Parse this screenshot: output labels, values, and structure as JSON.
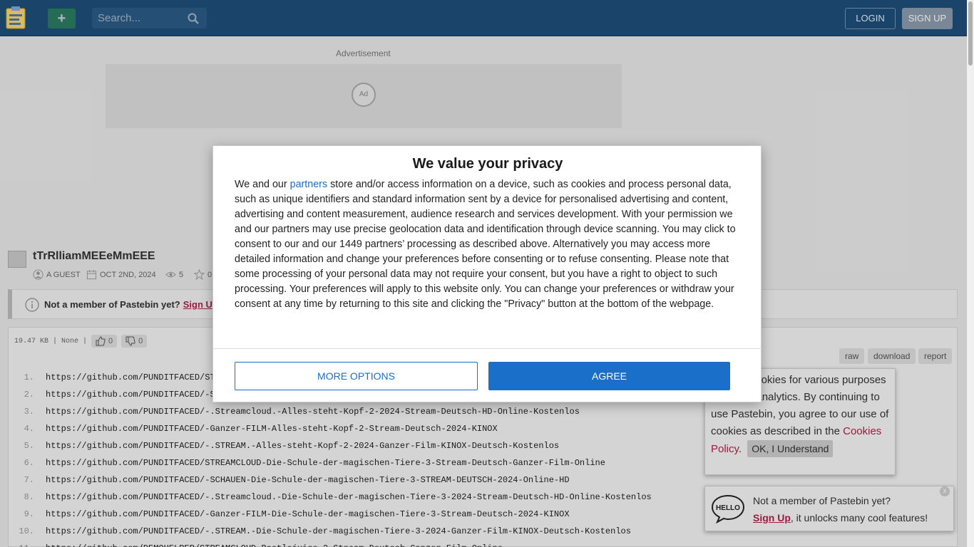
{
  "header": {
    "search_placeholder": "Search...",
    "login_label": "LOGIN",
    "signup_label": "SIGN UP",
    "add_label": "+"
  },
  "ad": {
    "label": "Advertisement",
    "badge": "Ad"
  },
  "paste": {
    "title": "tTrRlliamMEEeMmEEE",
    "author": "A GUEST",
    "date": "OCT 2ND, 2024",
    "views": "5",
    "rating": "0",
    "size_info": "19.47 KB | None |",
    "likes": "0",
    "dislikes": "0",
    "tools": {
      "raw": "raw",
      "download": "download",
      "report": "report"
    }
  },
  "notice": {
    "text": "Not a member of Pastebin yet?",
    "link": "Sign Up"
  },
  "code_lines": [
    {
      "n": "1.",
      "t": "https://github.com/PUNDITFACED/STR"
    },
    {
      "n": "2.",
      "t": "https://github.com/PUNDITFACED/-SC"
    },
    {
      "n": "3.",
      "t": "https://github.com/PUNDITFACED/-.Streamcloud.-Alles-steht-Kopf-2-2024-Stream-Deutsch-HD-Online-Kostenlos"
    },
    {
      "n": "4.",
      "t": "https://github.com/PUNDITFACED/-Ganzer-FILM-Alles-steht-Kopf-2-Stream-Deutsch-2024-KINOX"
    },
    {
      "n": "5.",
      "t": "https://github.com/PUNDITFACED/-.STREAM.-Alles-steht-Kopf-2-2024-Ganzer-Film-KINOX-Deutsch-Kostenlos"
    },
    {
      "n": "6.",
      "t": "https://github.com/PUNDITFACED/STREAMCLOUD-Die-Schule-der-magischen-Tiere-3-Stream-Deutsch-Ganzer-Film-Online"
    },
    {
      "n": "7.",
      "t": "https://github.com/PUNDITFACED/-SCHAUEN-Die-Schule-der-magischen-Tiere-3-STREAM-DEUTSCH-2024-Online-HD"
    },
    {
      "n": "8.",
      "t": "https://github.com/PUNDITFACED/-.Streamcloud.-Die-Schule-der-magischen-Tiere-3-2024-Stream-Deutsch-HD-Online-Kostenlos"
    },
    {
      "n": "9.",
      "t": "https://github.com/PUNDITFACED/-Ganzer-FILM-Die-Schule-der-magischen-Tiere-3-Stream-Deutsch-2024-KINOX"
    },
    {
      "n": "10.",
      "t": "https://github.com/PUNDITFACED/-.STREAM.-Die-Schule-der-magischen-Tiere-3-2024-Ganzer-Film-KINOX-Deutsch-Kostenlos"
    },
    {
      "n": "11.",
      "t": "https://github.com/DEMOHELPER/STREAMCLOUD-Beetlejuice-2-Stream-Deutsch-Ganzer-Film-Online"
    }
  ],
  "cookie_popup": {
    "text_before": "We use cookies for various purposes including analytics. By continuing to use Pastebin, you agree to our use of cookies as described in the",
    "link": "Cookies Policy",
    "period": ".",
    "ok_label": "OK, I Understand"
  },
  "member_popup": {
    "line1": "Not a member of Pastebin yet?",
    "link": "Sign Up",
    "line2_rest": ", it unlocks many cool features!",
    "close": "x"
  },
  "consent": {
    "title": "We value your privacy",
    "body_before": "We and our",
    "partners_link": "partners",
    "body_after": "store and/or access information on a device, such as cookies and process personal data, such as unique identifiers and standard information sent by a device for personalised advertising and content, advertising and content measurement, audience research and services development. With your permission we and our partners may use precise geolocation data and identification through device scanning. You may click to consent to our and our 1449 partners’ processing as described above. Alternatively you may access more detailed information and change your preferences before consenting or to refuse consenting. Please note that some processing of your personal data may not require your consent, but you have a right to object to such processing. Your preferences will apply to this website only. You can change your preferences or withdraw your consent at any time by returning to this site and clicking the \"Privacy\" button at the bottom of the webpage.",
    "more_options": "MORE OPTIONS",
    "agree": "AGREE"
  },
  "colors": {
    "header_bg": "#1f4e79",
    "accent_blue": "#1a6fc9",
    "link_red": "#b0204a",
    "add_green": "#2e8b57"
  }
}
